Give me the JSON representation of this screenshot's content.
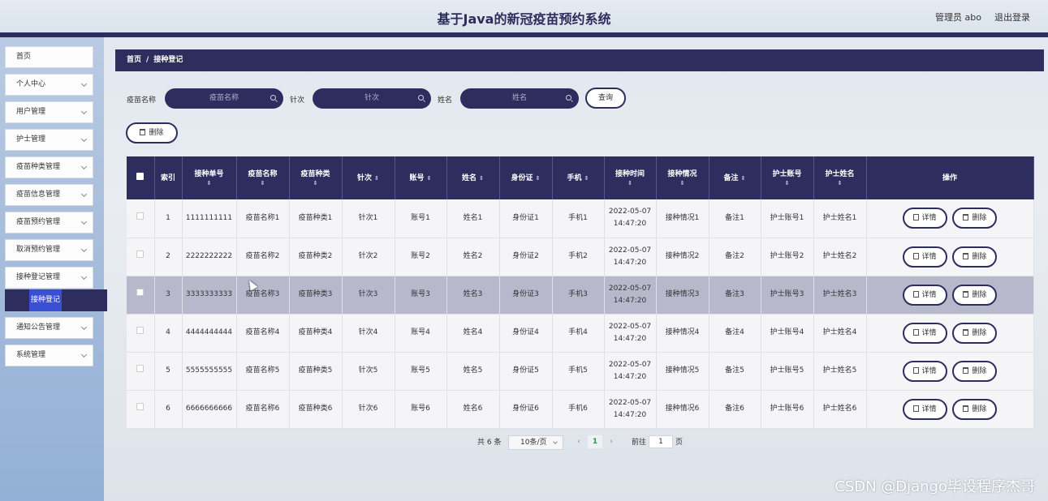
{
  "header": {
    "title": "基于Java的新冠疫苗预约系统",
    "user": "管理员 abo",
    "logout": "退出登录"
  },
  "sidebar": {
    "items": [
      {
        "label": "首页",
        "chevron": false
      },
      {
        "label": "个人中心",
        "chevron": true
      },
      {
        "label": "用户管理",
        "chevron": true
      },
      {
        "label": "护士管理",
        "chevron": true
      },
      {
        "label": "疫苗种类管理",
        "chevron": true
      },
      {
        "label": "疫苗信息管理",
        "chevron": true
      },
      {
        "label": "疫苗预约管理",
        "chevron": true
      },
      {
        "label": "取消预约管理",
        "chevron": true
      },
      {
        "label": "接种登记管理",
        "chevron": true
      },
      {
        "label": "通知公告管理",
        "chevron": true
      },
      {
        "label": "系统管理",
        "chevron": true
      }
    ],
    "active_sub": "接种登记"
  },
  "breadcrumb": {
    "home": "首页",
    "sep": "/",
    "current": "接种登记"
  },
  "search": {
    "vaccine_label": "疫苗名称",
    "vaccine_placeholder": "疫苗名称",
    "dose_label": "针次",
    "dose_placeholder": "针次",
    "name_label": "姓名",
    "name_placeholder": "姓名",
    "query_button": "查询"
  },
  "toolbar": {
    "delete_button": "删除"
  },
  "table": {
    "headers": [
      "索引",
      "接种单号",
      "疫苗名称",
      "疫苗种类",
      "针次",
      "账号",
      "姓名",
      "身份证",
      "手机",
      "接种时间",
      "接种情况",
      "备注",
      "护士账号",
      "护士姓名",
      "操作"
    ],
    "rows": [
      {
        "index": "1",
        "no": "1111111111",
        "vaccine": "疫苗名称1",
        "type": "疫苗种类1",
        "dose": "针次1",
        "account": "账号1",
        "name": "姓名1",
        "idcard": "身份证1",
        "phone": "手机1",
        "time": "2022-05-07 14:47:20",
        "status": "接种情况1",
        "remark": "备注1",
        "nurse_account": "护士账号1",
        "nurse_name": "护士姓名1"
      },
      {
        "index": "2",
        "no": "2222222222",
        "vaccine": "疫苗名称2",
        "type": "疫苗种类2",
        "dose": "针次2",
        "account": "账号2",
        "name": "姓名2",
        "idcard": "身份证2",
        "phone": "手机2",
        "time": "2022-05-07 14:47:20",
        "status": "接种情况2",
        "remark": "备注2",
        "nurse_account": "护士账号2",
        "nurse_name": "护士姓名2"
      },
      {
        "index": "3",
        "no": "3333333333",
        "vaccine": "疫苗名称3",
        "type": "疫苗种类3",
        "dose": "针次3",
        "account": "账号3",
        "name": "姓名3",
        "idcard": "身份证3",
        "phone": "手机3",
        "time": "2022-05-07 14:47:20",
        "status": "接种情况3",
        "remark": "备注3",
        "nurse_account": "护士账号3",
        "nurse_name": "护士姓名3"
      },
      {
        "index": "4",
        "no": "4444444444",
        "vaccine": "疫苗名称4",
        "type": "疫苗种类4",
        "dose": "针次4",
        "account": "账号4",
        "name": "姓名4",
        "idcard": "身份证4",
        "phone": "手机4",
        "time": "2022-05-07 14:47:20",
        "status": "接种情况4",
        "remark": "备注4",
        "nurse_account": "护士账号4",
        "nurse_name": "护士姓名4"
      },
      {
        "index": "5",
        "no": "5555555555",
        "vaccine": "疫苗名称5",
        "type": "疫苗种类5",
        "dose": "针次5",
        "account": "账号5",
        "name": "姓名5",
        "idcard": "身份证5",
        "phone": "手机5",
        "time": "2022-05-07 14:47:20",
        "status": "接种情况5",
        "remark": "备注5",
        "nurse_account": "护士账号5",
        "nurse_name": "护士姓名5"
      },
      {
        "index": "6",
        "no": "6666666666",
        "vaccine": "疫苗名称6",
        "type": "疫苗种类6",
        "dose": "针次6",
        "account": "账号6",
        "name": "姓名6",
        "idcard": "身份证6",
        "phone": "手机6",
        "time": "2022-05-07 14:47:20",
        "status": "接种情况6",
        "remark": "备注6",
        "nurse_account": "护士账号6",
        "nurse_name": "护士姓名6"
      }
    ],
    "detail_button": "详情",
    "delete_button": "删除"
  },
  "pagination": {
    "total": "共 6 条",
    "page_size": "10条/页",
    "current": "1",
    "goto_label": "前往",
    "goto_value": "1",
    "page_unit": "页"
  },
  "watermark": "CSDN @Django毕设程序杰哥"
}
